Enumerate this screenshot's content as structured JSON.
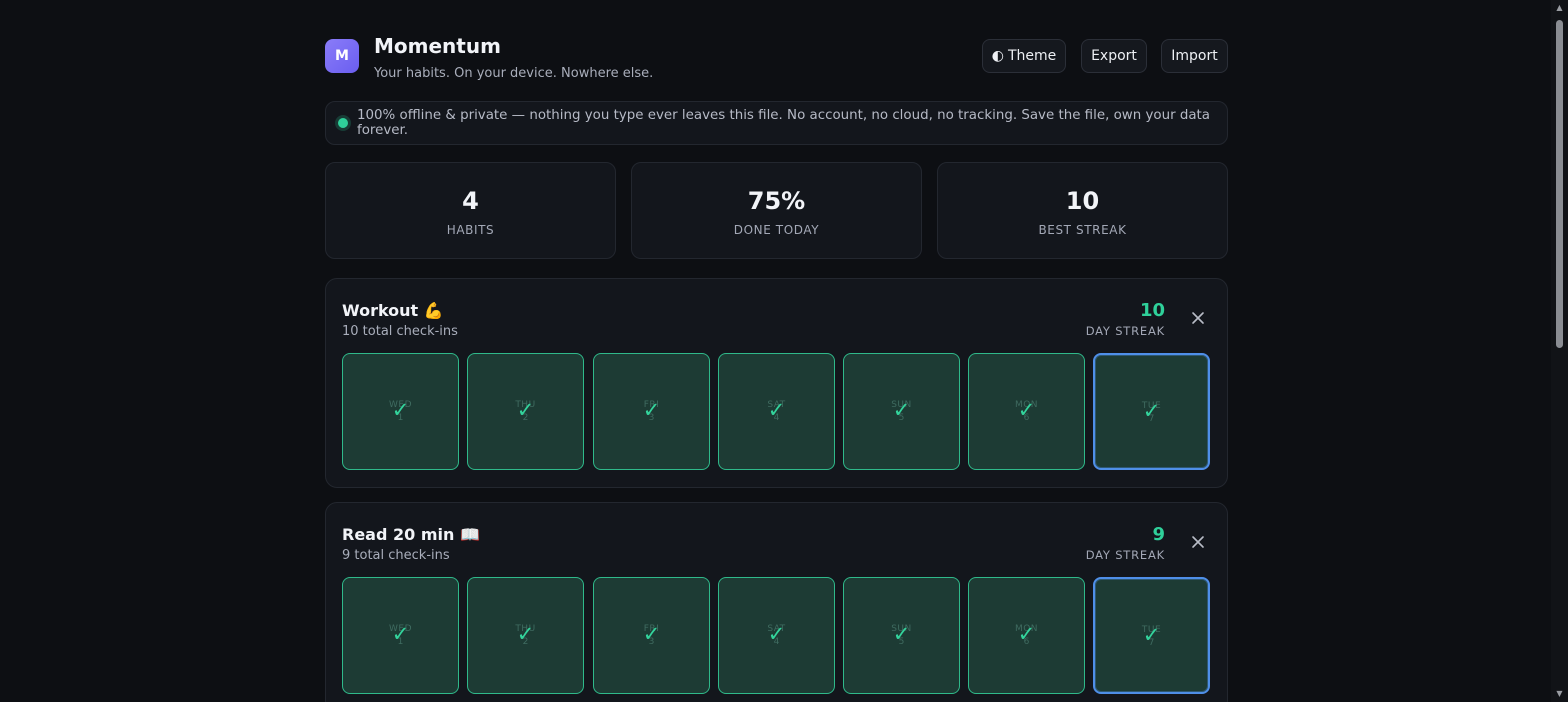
{
  "app": {
    "logo_letter": "M",
    "title": "Momentum",
    "subtitle": "Your habits. On your device. Nowhere else."
  },
  "toolbar": {
    "theme_icon": "◐",
    "theme_label": "Theme",
    "export_label": "Export",
    "import_label": "Import"
  },
  "banner": {
    "text": "100% offline & private — nothing you type ever leaves this file. No account, no cloud, no tracking. Save the file, own your data forever."
  },
  "stats": [
    {
      "value": "4",
      "label": "HABITS"
    },
    {
      "value": "75%",
      "label": "DONE TODAY"
    },
    {
      "value": "10",
      "label": "BEST STREAK"
    }
  ],
  "habits": [
    {
      "name": "Workout 💪",
      "checkins": "10 total check-ins",
      "streak": "10",
      "streak_label": "DAY STREAK",
      "days": [
        {
          "day": "WED",
          "num": "1",
          "done": true
        },
        {
          "day": "THU",
          "num": "2",
          "done": true
        },
        {
          "day": "FRI",
          "num": "3",
          "done": true
        },
        {
          "day": "SAT",
          "num": "4",
          "done": true
        },
        {
          "day": "SUN",
          "num": "5",
          "done": true
        },
        {
          "day": "MON",
          "num": "6",
          "done": true
        },
        {
          "day": "TUE",
          "num": "7",
          "done": true
        }
      ]
    },
    {
      "name": "Read 20 min 📖",
      "checkins": "9 total check-ins",
      "streak": "9",
      "streak_label": "DAY STREAK",
      "days": [
        {
          "day": "WED",
          "num": "1",
          "done": true
        },
        {
          "day": "THU",
          "num": "2",
          "done": true
        },
        {
          "day": "FRI",
          "num": "3",
          "done": true
        },
        {
          "day": "SAT",
          "num": "4",
          "done": true
        },
        {
          "day": "SUN",
          "num": "5",
          "done": true
        },
        {
          "day": "MON",
          "num": "6",
          "done": true
        },
        {
          "day": "TUE",
          "num": "7",
          "done": true
        }
      ]
    }
  ],
  "check_glyph": "✓",
  "colors": {
    "accent_green": "#2fd09a",
    "today_outline": "#4f8fe8",
    "logo_purple": "#7a6cf4"
  }
}
